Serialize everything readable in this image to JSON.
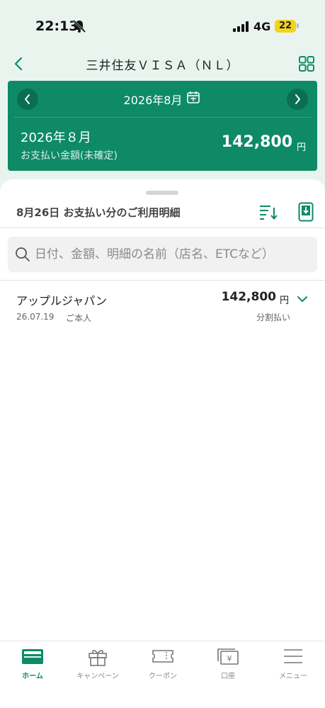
{
  "status_bar": {
    "time": "22:13",
    "network": "4G",
    "battery": "22"
  },
  "header": {
    "title": "三井住友ＶＩＳＡ（ＮＬ）"
  },
  "summary": {
    "nav_month": "2026年8月",
    "billing_month": "2026年８月",
    "billing_label": "お支払い金額(未確定)",
    "amount": "142,800",
    "currency": "円"
  },
  "details": {
    "title": "8月26日 お支払い分のご利用明細",
    "search_placeholder": "日付、金額、明細の名前（店名、ETCなど）"
  },
  "transactions": [
    {
      "merchant": "アップルジャパン",
      "date": "26.07.19",
      "holder": "ご本人",
      "amount": "142,800",
      "currency": "円",
      "payment_type": "分割払い"
    }
  ],
  "tabs": [
    {
      "label": "ホーム",
      "icon": "wallet-icon",
      "active": true
    },
    {
      "label": "キャンペーン",
      "icon": "gift-icon",
      "active": false
    },
    {
      "label": "クーポン",
      "icon": "coupon-icon",
      "active": false
    },
    {
      "label": "口座",
      "icon": "bank-account-icon",
      "active": false
    },
    {
      "label": "メニュー",
      "icon": "menu-icon",
      "active": false
    }
  ],
  "colors": {
    "brand_green": "#0e8a67",
    "background": "#e9f4ef"
  }
}
